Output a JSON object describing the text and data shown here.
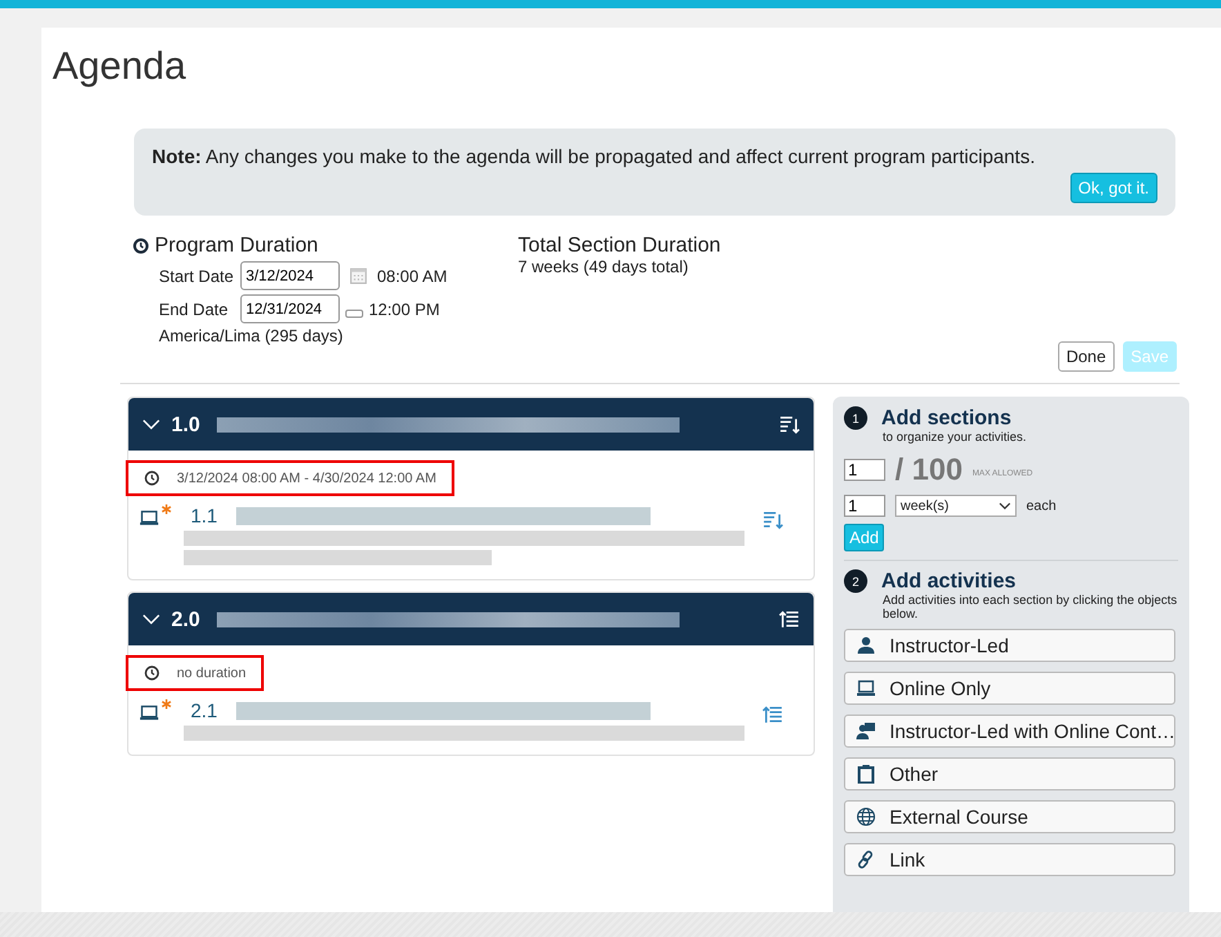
{
  "page": {
    "title": "Agenda"
  },
  "note": {
    "label": "Note:",
    "text": "Any changes you make to the agenda will be propagated and affect current program participants.",
    "button": "Ok, got it."
  },
  "program_duration": {
    "title": "Program Duration",
    "start_label": "Start Date",
    "start_value": "3/12/2024",
    "start_time": "08:00 AM",
    "end_label": "End Date",
    "end_value": "12/31/2024",
    "end_time": "12:00 PM",
    "timezone": "America/Lima (295 days)"
  },
  "total_duration": {
    "title": "Total Section Duration",
    "value": "7 weeks (49 days total)"
  },
  "actions": [
    {
      "label": "Done",
      "disabled": false
    },
    {
      "label": "Save",
      "disabled": true
    }
  ],
  "sections": [
    {
      "number": "1.0",
      "kind": "sort_down",
      "duration": "3/12/2024 08:00 AM - 4/30/2024 12:00 AM",
      "highlighted": true,
      "activities": [
        {
          "number": "1.1",
          "kind": "sort_down"
        }
      ]
    },
    {
      "number": "2.0",
      "kind": "sort_up",
      "duration": "no duration",
      "highlighted": true,
      "activities": [
        {
          "number": "2.1",
          "kind": "sort_up"
        }
      ]
    }
  ],
  "add_sections": {
    "step": "1",
    "title": "Add sections",
    "subtitle": "to organize your activities.",
    "count": "1",
    "max": "/ 100",
    "max_note": "MAX ALLOWED",
    "interval": "1",
    "unit": "week(s)",
    "each": "each",
    "button": "Add"
  },
  "add_activities": {
    "step": "2",
    "title": "Add activities",
    "subtitle": "Add activities into each section by clicking the objects below.",
    "items": [
      {
        "kind": "instructor",
        "label": "Instructor-Led"
      },
      {
        "kind": "online",
        "label": "Online Only"
      },
      {
        "kind": "blended",
        "label": "Instructor-Led with Online Cont…"
      },
      {
        "kind": "other",
        "label": "Other"
      },
      {
        "kind": "external",
        "label": "External Course"
      },
      {
        "kind": "link",
        "label": "Link"
      }
    ]
  }
}
